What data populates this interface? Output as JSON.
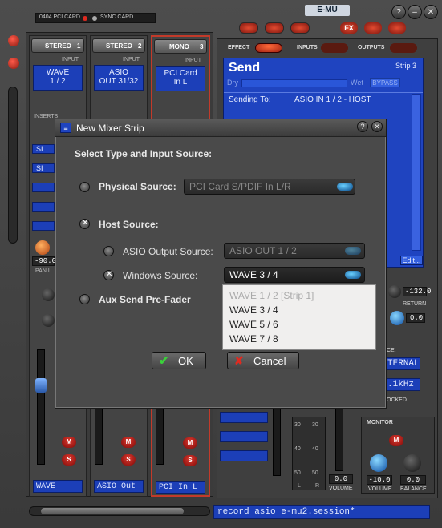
{
  "title_bar": {
    "card_label": "0404 PCI CARD",
    "sync_label": "SYNC CARD",
    "brand": "E-MU"
  },
  "toolbar": {
    "fx_label": "FX"
  },
  "strips": [
    {
      "type": "STEREO",
      "number": "1",
      "input_label": "INPUT",
      "input_value_1": "WAVE",
      "input_value_2": "1 / 2",
      "footer": "WAVE"
    },
    {
      "type": "STEREO",
      "number": "2",
      "input_label": "INPUT",
      "input_value_1": "ASIO",
      "input_value_2": "OUT 31/32",
      "footer": "ASIO Out"
    },
    {
      "type": "MONO",
      "number": "3",
      "input_label": "INPUT",
      "input_value_1": "PCI Card",
      "input_value_2": "In L",
      "footer": "PCI In L"
    }
  ],
  "left_strip_extra": {
    "inserts_label": "INSERTS",
    "insert_items": [
      "SI",
      "SI"
    ],
    "pan_value": "-90.0",
    "pan_label": "PAN L"
  },
  "right_panel": {
    "effect_label": "EFFECT",
    "inputs_label": "INPUTS",
    "outputs_label": "OUTPUTS",
    "send_title": "Send",
    "strip_label": "Strip 3",
    "dry_label": "Dry",
    "wet_label": "Wet",
    "bypass_label": "BYPASS",
    "edit_label": "Edit...",
    "sending_to_label": "Sending To:",
    "sending_to_value": "ASIO IN 1 / 2 - HOST",
    "return_value": "-132.0",
    "return_label": "RETURN",
    "return_knob_value": "0.0",
    "clock_source_label": "CE:",
    "clock_value": "TERNAL",
    "rate_value": ".1kHz",
    "locked_label": "OCKED",
    "meter_ticks": [
      "30",
      "40",
      "50"
    ],
    "meter_l": "L",
    "meter_r": "R",
    "volume_value": "0.0",
    "volume_label": "VOLUME",
    "monitor_label": "MONITOR",
    "monitor_volume_value": "-10.0",
    "monitor_balance_value": "0.0",
    "monitor_volume_label": "VOLUME",
    "monitor_balance_label": "BALANCE"
  },
  "status_bar": {
    "session": "record asio e-mu2.session*"
  },
  "dialog": {
    "title": "New Mixer Strip",
    "heading": "Select Type and Input Source:",
    "physical_source_label": "Physical Source:",
    "physical_source_value": "PCI Card S/PDIF In L/R",
    "host_source_label": "Host Source:",
    "asio_output_label": "ASIO Output Source:",
    "asio_output_value": "ASIO OUT 1 / 2",
    "windows_source_label": "Windows Source:",
    "windows_source_value": "WAVE 3 / 4",
    "aux_send_label": "Aux Send Pre-Fader",
    "dropdown_options": [
      "WAVE 1 / 2  [Strip 1]",
      "WAVE 3 / 4",
      "WAVE 5 / 6",
      "WAVE 7 / 8"
    ],
    "ok_label": "OK",
    "cancel_label": "Cancel",
    "help_icon": "?",
    "close_icon": "✕"
  },
  "colors": {
    "lcd_blue": "#1c3fb8",
    "accent_red": "#d03020"
  }
}
